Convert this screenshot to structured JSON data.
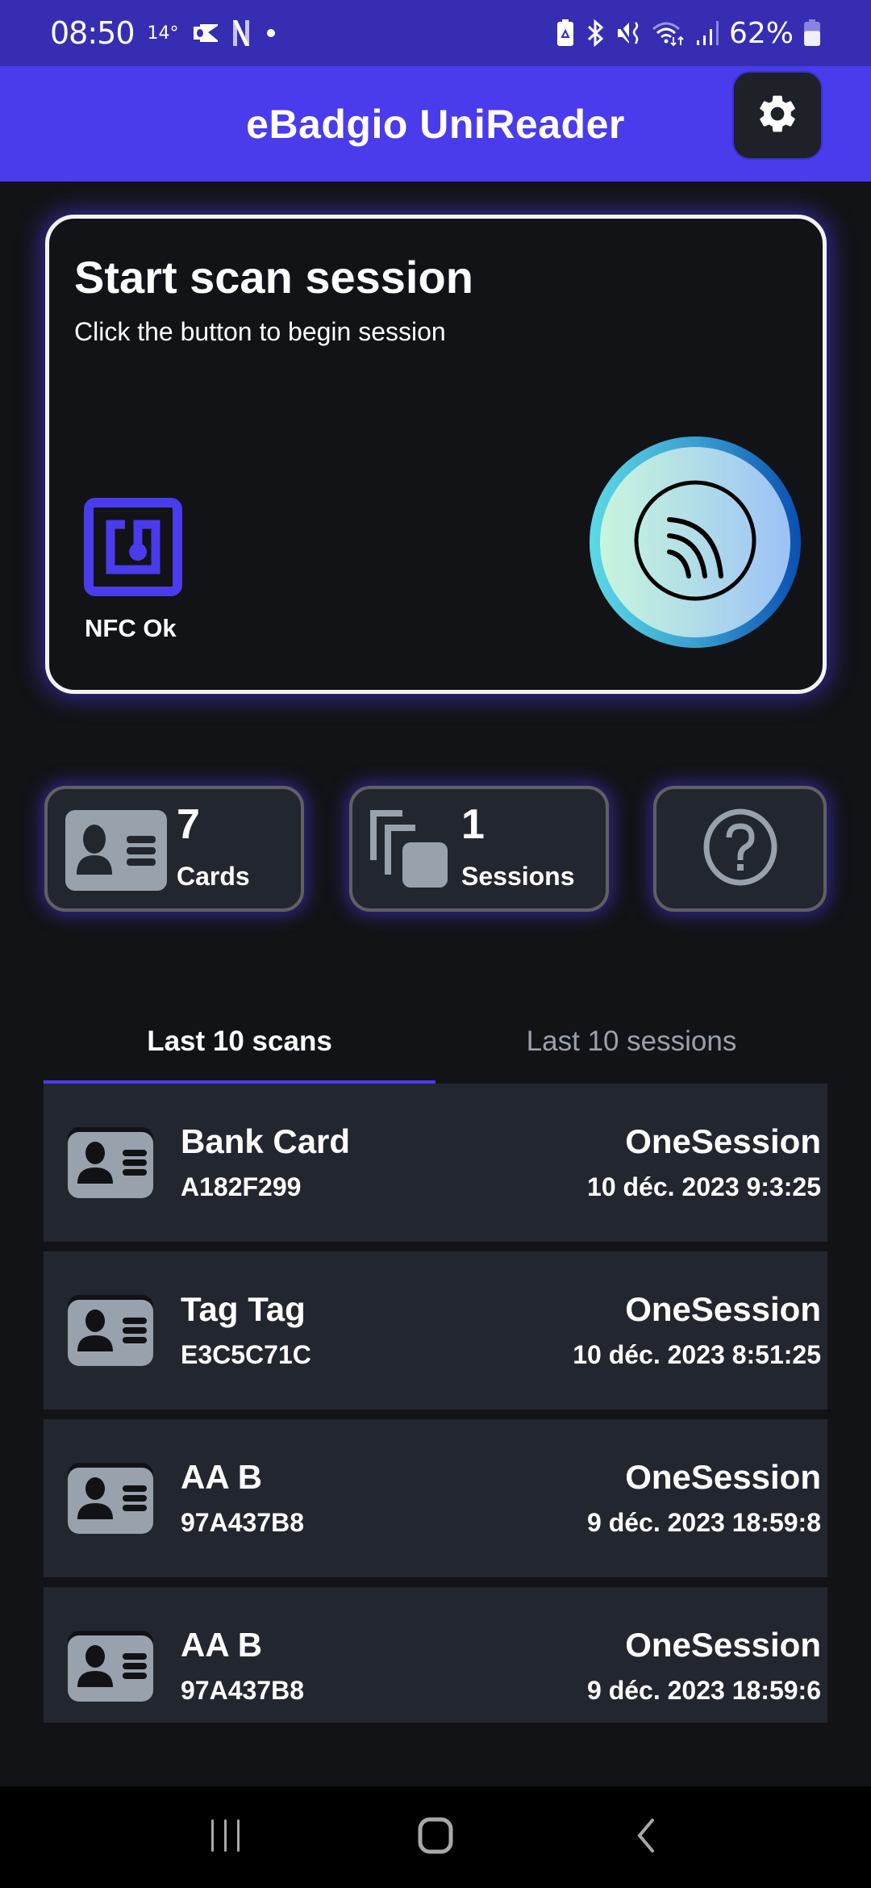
{
  "status_bar": {
    "time": "08:50",
    "temperature": "14°",
    "notification_icons": [
      "outlook-icon",
      "netflix-icon",
      "dot-icon"
    ],
    "system_icons": [
      "battery-saver-icon",
      "bluetooth-icon",
      "mute-vibrate-icon",
      "wifi-icon",
      "signal-icon"
    ],
    "battery_percent": "62%",
    "battery_level": 0.62
  },
  "app_bar": {
    "title": "eBadgio UniReader",
    "settings_icon": "gear-icon"
  },
  "start_card": {
    "title": "Start scan session",
    "subtitle": "Click the button to begin session",
    "nfc_status": "NFC Ok",
    "nfc_icon": "nfc-icon",
    "scan_button_icon": "contactless-icon"
  },
  "stats": {
    "cards": {
      "count": "7",
      "label": "Cards",
      "icon": "id-card-icon"
    },
    "sessions": {
      "count": "1",
      "label": "Sessions",
      "icon": "stacked-cards-icon"
    },
    "help": {
      "icon": "help-icon"
    }
  },
  "tabs": [
    {
      "label": "Last 10 scans",
      "active": true
    },
    {
      "label": "Last 10 sessions",
      "active": false
    }
  ],
  "scans": [
    {
      "name": "Bank Card",
      "uid": "A182F299",
      "session": "OneSession",
      "date": "10 déc. 2023 9:3:25"
    },
    {
      "name": "Tag Tag",
      "uid": "E3C5C71C",
      "session": "OneSession",
      "date": "10 déc. 2023 8:51:25"
    },
    {
      "name": "AA B",
      "uid": "97A437B8",
      "session": "OneSession",
      "date": "9 déc. 2023 18:59:8"
    },
    {
      "name": "AA B",
      "uid": "97A437B8",
      "session": "OneSession",
      "date": "9 déc. 2023 18:59:6"
    }
  ],
  "colors": {
    "accent": "#4a3bec",
    "status_bar": "#372db3",
    "background": "#121316",
    "card_surface": "#22272f",
    "muted_icon": "#98a1ac"
  },
  "nav_bar": {
    "buttons": [
      "recents-icon",
      "home-icon",
      "back-icon"
    ]
  }
}
